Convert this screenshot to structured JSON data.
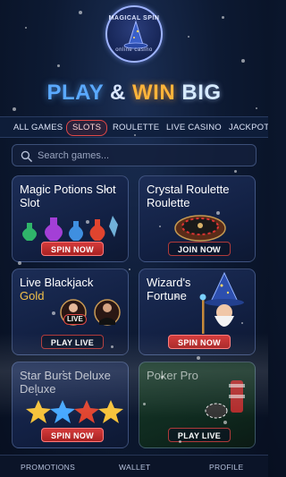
{
  "logo": {
    "top_text": "MAGICAL SPIN",
    "bottom_text": "online casino"
  },
  "headline": {
    "play": "PLAY",
    "amp": "&",
    "win": "WIN",
    "big": "BIG"
  },
  "tabs": [
    {
      "label": "ALL GAMES",
      "active": false
    },
    {
      "label": "SLOTS",
      "active": true
    },
    {
      "label": "ROULETTE",
      "active": false
    },
    {
      "label": "LIVE CASINO",
      "active": false
    },
    {
      "label": "JACKPOTS",
      "active": false
    }
  ],
  "search": {
    "placeholder": "Search games..."
  },
  "cards": [
    {
      "title": "Magic Potions Slot Slot",
      "button": "SPIN NOW"
    },
    {
      "title": "Crystal Roulette Roulette",
      "button": "JOIN NOW"
    },
    {
      "title_main": "Live Blackjack",
      "title_gold": "Gold",
      "badge": "LIVE",
      "button": "PLAY LIVE"
    },
    {
      "title": "Wizard's Fortune",
      "button": "SPIN NOW"
    },
    {
      "title": "Star Burst Deluxe Deluxe",
      "button": "SPIN NOW"
    },
    {
      "title": "Poker Pro",
      "button": "PLAY LIVE"
    }
  ],
  "bottom_nav": [
    {
      "label": "PROMOTIONS"
    },
    {
      "label": "WALLET"
    },
    {
      "label": "PROFILE"
    }
  ],
  "colors": {
    "accent_blue": "#5aa9ff",
    "accent_gold": "#ffb43a",
    "button_red": "#c83030",
    "background": "#0d1a33"
  }
}
